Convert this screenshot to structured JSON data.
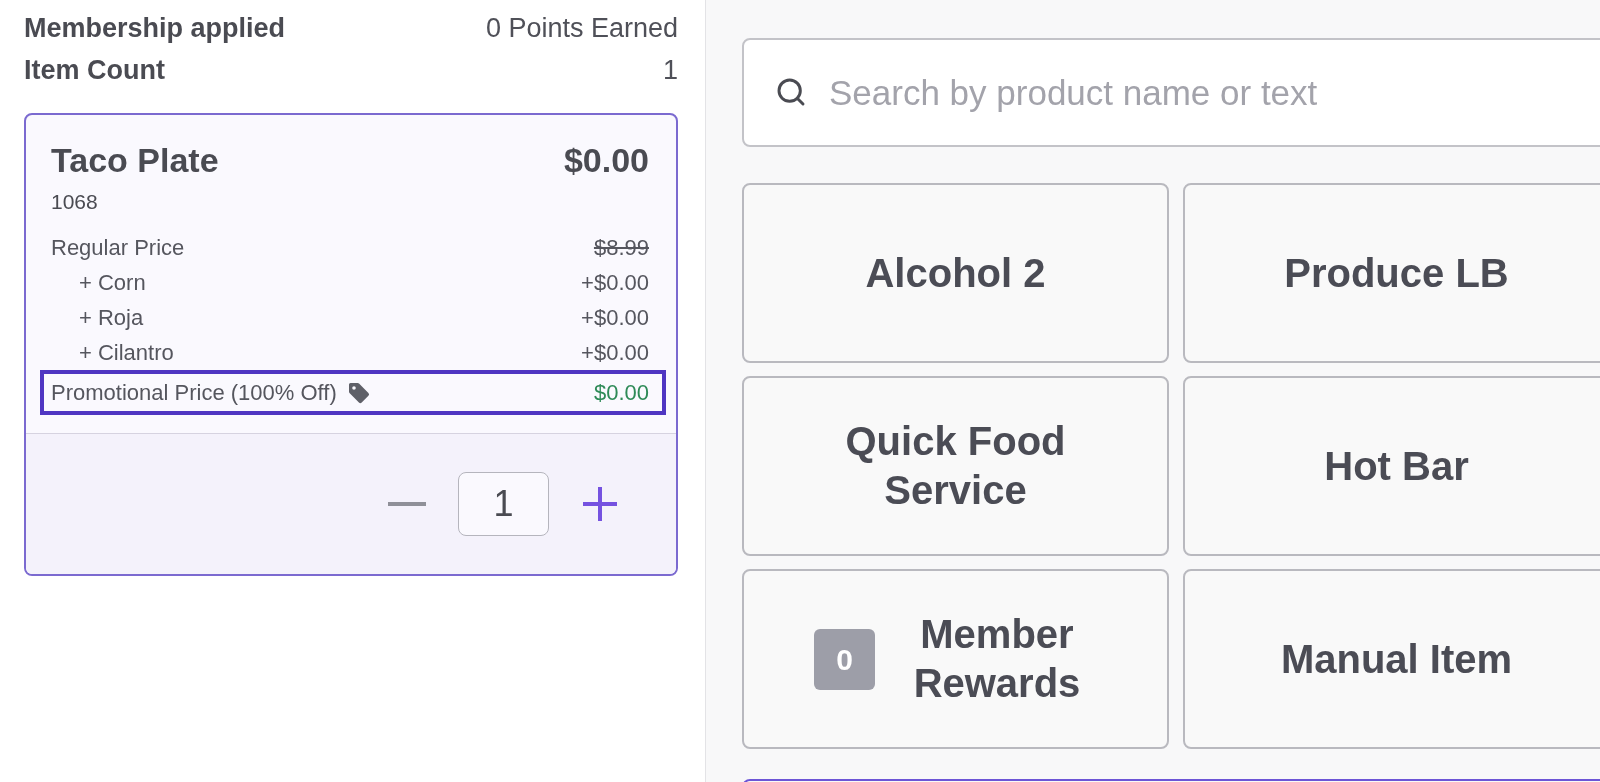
{
  "summary": [
    {
      "label": "Membership applied",
      "value": "0 Points Earned"
    },
    {
      "label": "Item Count",
      "value": "1"
    }
  ],
  "cart_item": {
    "name": "Taco Plate",
    "price": "$0.00",
    "sku": "1068",
    "price_lines": [
      {
        "kind": "regular",
        "label": "Regular Price",
        "amount": "$8.99",
        "highlighted": false
      },
      {
        "kind": "modifier",
        "label": "+ Corn",
        "amount": "+$0.00",
        "highlighted": false
      },
      {
        "kind": "modifier",
        "label": "+ Roja",
        "amount": "+$0.00",
        "highlighted": false
      },
      {
        "kind": "modifier",
        "label": "+ Cilantro",
        "amount": "+$0.00",
        "highlighted": false
      },
      {
        "kind": "promo",
        "label": "Promotional Price (100% Off)",
        "amount": "$0.00",
        "highlighted": true
      }
    ],
    "quantity": "1"
  },
  "search": {
    "placeholder": "Search by product name or text"
  },
  "tiles": [
    {
      "label": "Alcohol 2"
    },
    {
      "label": "Produce LB"
    },
    {
      "label": "Quick Food Service"
    },
    {
      "label": "Hot Bar"
    },
    {
      "label": "Member Rewards",
      "badge": "0"
    },
    {
      "label": "Manual Item"
    }
  ]
}
